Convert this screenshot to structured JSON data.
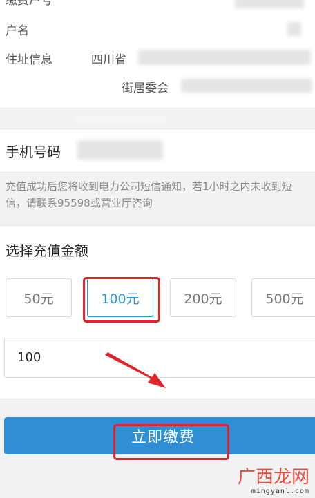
{
  "account": {
    "row1_label": "缴费户号",
    "name_label": "户名",
    "address_label": "住址信息",
    "address_line1": "四川省",
    "address_line2": "街居委会"
  },
  "phone": {
    "label": "手机号码"
  },
  "notice": "充值成功后您将收到电力公司短信通知，若1小时之内未收到短信，请联系95598或营业厅咨询",
  "amount": {
    "title": "选择充值金额",
    "options": [
      "50元",
      "100元",
      "200元",
      "500元"
    ],
    "selected": "100元",
    "custom_value": "100"
  },
  "pay_button": "立即缴费",
  "watermark": {
    "text": "广西龙网",
    "url": "mingyanl.com"
  },
  "colors": {
    "accent": "#2e8fd4",
    "highlight": "#e0242a",
    "watermark": "#e84b3c"
  }
}
